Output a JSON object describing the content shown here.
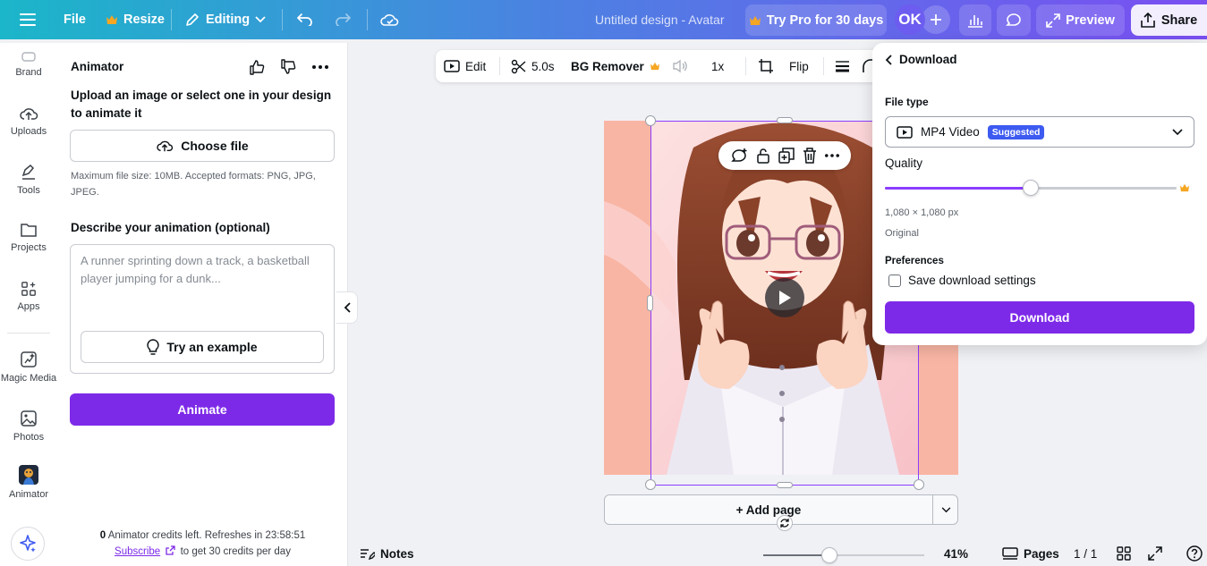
{
  "topbar": {
    "file_label": "File",
    "resize_label": "Resize",
    "editing_label": "Editing",
    "design_title": "Untitled design - Avatar",
    "try_pro_label": "Try Pro for 30 days",
    "avatar_initials": "OK",
    "preview_label": "Preview",
    "share_label": "Share"
  },
  "rail": {
    "items": [
      {
        "label": "Brand",
        "icon": "brand-icon"
      },
      {
        "label": "Uploads",
        "icon": "cloud-upload-icon"
      },
      {
        "label": "Tools",
        "icon": "pen-tool-icon"
      },
      {
        "label": "Projects",
        "icon": "folder-icon"
      },
      {
        "label": "Apps",
        "icon": "apps-grid-icon"
      },
      {
        "label": "Magic Media",
        "icon": "magic-media-icon"
      },
      {
        "label": "Photos",
        "icon": "photo-icon"
      },
      {
        "label": "Animator",
        "icon": "animator-app-icon"
      }
    ]
  },
  "panel": {
    "title": "Animator",
    "upload_text": "Upload an image or select one in your design to animate it",
    "choose_file_label": "Choose file",
    "hint": "Maximum file size: 10MB. Accepted formats: PNG, JPG, JPEG.",
    "describe_label": "Describe your animation (optional)",
    "describe_placeholder": "A runner sprinting down a track, a basketball player jumping for a dunk...",
    "try_example_label": "Try an example",
    "animate_label": "Animate",
    "credits_count": "0",
    "credits_text": " Animator credits left. Refreshes in 23:58:51",
    "subscribe_label": "Subscribe",
    "subscribe_suffix": " to get 30 credits per day"
  },
  "toolbar": {
    "edit_label": "Edit",
    "duration_label": "5.0s",
    "bg_remover_label": "BG Remover",
    "speed_label": "1x",
    "flip_label": "Flip"
  },
  "canvas": {
    "add_page_label": "+ Add page"
  },
  "bottombar": {
    "notes_label": "Notes",
    "zoom_label": "41%",
    "zoom_value": 0.41,
    "pages_label": "Pages",
    "page_count": "1 / 1"
  },
  "download": {
    "back_label": "Download",
    "file_type_label": "File type",
    "file_type_value": "MP4 Video",
    "suggested_badge": "Suggested",
    "quality_label": "Quality",
    "quality_value": 0.5,
    "resolution": "1,080 × 1,080 px",
    "resolution_note": "Original",
    "preferences_label": "Preferences",
    "save_settings_label": "Save download settings",
    "download_button_label": "Download"
  },
  "colors": {
    "brand_purple": "#7d2ae8",
    "accent_purple": "#8b3dff",
    "badge_blue": "#3d5af1",
    "pro_crown": "#f5a623"
  }
}
